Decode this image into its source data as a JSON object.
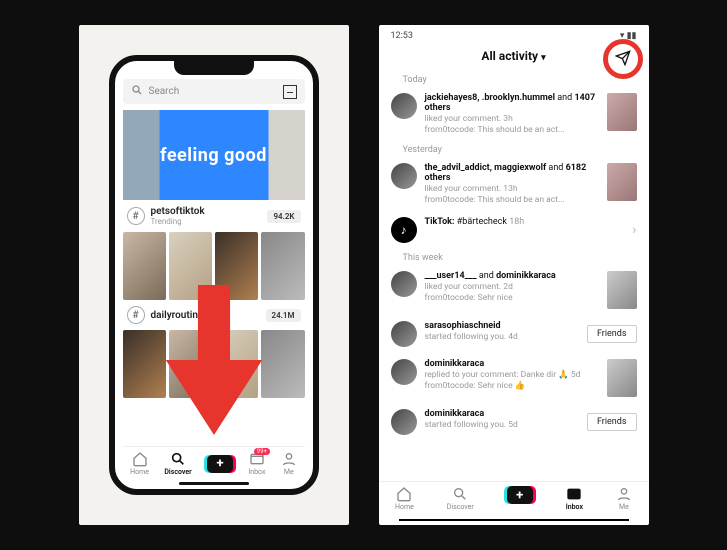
{
  "left": {
    "search_placeholder": "Search",
    "banner_text": "feeling good",
    "hashtags": [
      {
        "name": "petsoftiktok",
        "sub": "Trending",
        "count": "94.2K"
      },
      {
        "name": "dailyroutine",
        "sub": "",
        "count": "24.1M"
      }
    ],
    "nav": {
      "home": "Home",
      "discover": "Discover",
      "inbox": "Inbox",
      "me": "Me",
      "inbox_badge": "99+"
    },
    "arrow_color": "#e7352e"
  },
  "right": {
    "status_time": "12:53",
    "header_title": "All activity",
    "sections": {
      "today": "Today",
      "yesterday": "Yesterday",
      "thisweek": "This week"
    },
    "items": {
      "a": {
        "bold": "jackiehayes8, .brooklyn.hummel",
        "tail": " and ",
        "bold2": "1407 others",
        "sub_action": "liked your comment.",
        "sub_time": "3h",
        "quote": "from0tocode: This should be an act..."
      },
      "b": {
        "bold": "the_advil_addict, maggiexwolf",
        "tail": " and ",
        "bold2": "6182 others",
        "sub_action": "liked your comment.",
        "sub_time": "13h",
        "quote": "from0tocode: This should be an act..."
      },
      "c": {
        "bold": "TikTok:",
        "text": " #bärtecheck",
        "time": "18h"
      },
      "d": {
        "bold": "___user14___",
        "tail": " and ",
        "bold2": "dominikkaraca",
        "sub_action": "liked your comment.",
        "sub_time": "2d",
        "quote": "from0tocode: Sehr nice"
      },
      "e": {
        "bold": "sarasophiaschneid",
        "sub_action": "started following you.",
        "sub_time": "4d",
        "btn": "Friends"
      },
      "f": {
        "bold": "dominikkaraca",
        "sub_action": "replied to your comment: Danke dir 🙏",
        "sub_time": "5d",
        "quote": "from0tocode: Sehr nice 👍"
      },
      "g": {
        "bold": "dominikkaraca",
        "sub_action": "started following you.",
        "sub_time": "5d",
        "btn": "Friends"
      }
    },
    "nav": {
      "home": "Home",
      "discover": "Discover",
      "inbox": "Inbox",
      "me": "Me"
    }
  }
}
